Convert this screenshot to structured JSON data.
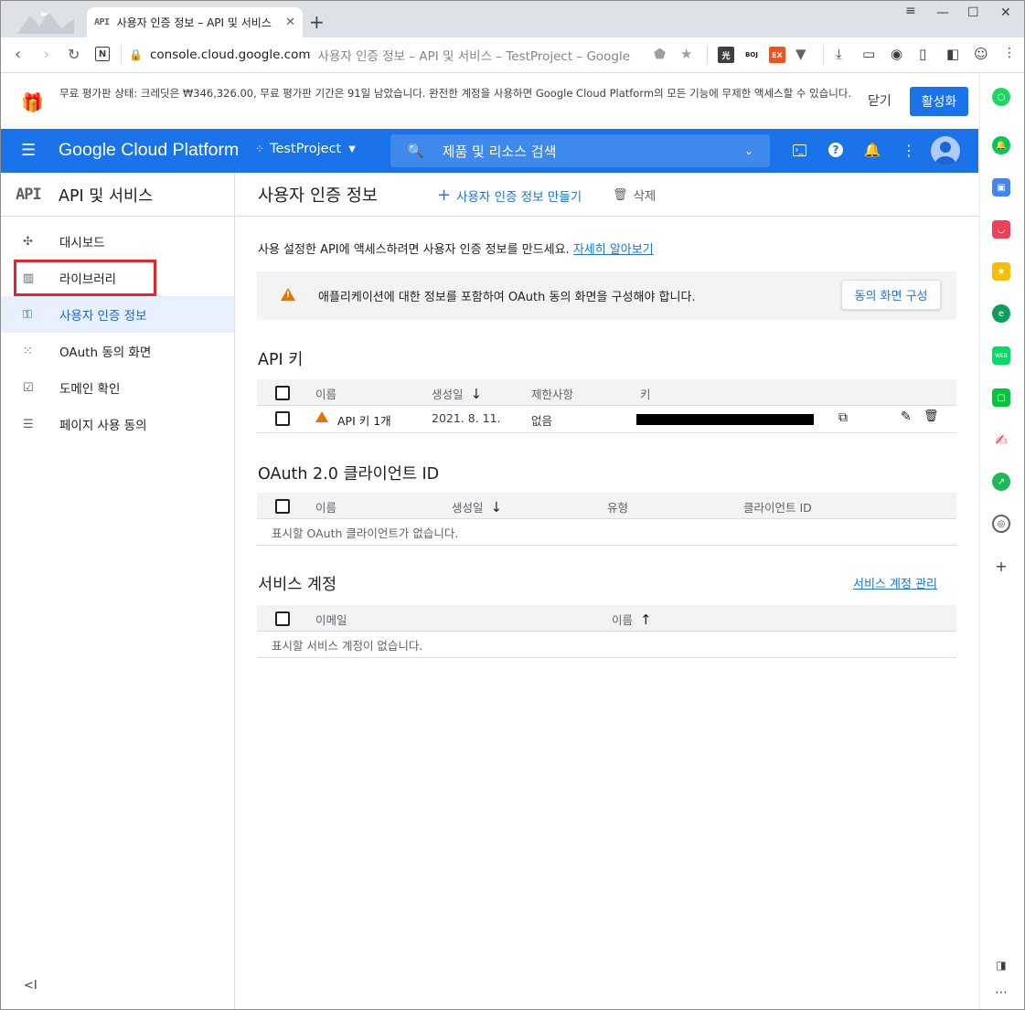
{
  "browser": {
    "tab_title": "사용자 인증 정보 – API 및 서비스",
    "tab_favicon": "API",
    "url_host": "console.cloud.google.com",
    "url_rest": "사용자 인증 정보 – API 및 서비스 – TestProject – Google",
    "extensions": [
      "光",
      "BOJ",
      "EX"
    ]
  },
  "banner": {
    "message": "무료 평가판 상태: 크레딧은 ₩346,326.00, 무료 평가판 기간은 91일 남았습니다. 완전한 계정을 사용하면 Google Cloud Platform의 모든 기능에 무제한 액세스할 수 있습니다.",
    "close_label": "닫기",
    "activate_label": "활성화"
  },
  "header": {
    "brand": "Google Cloud Platform",
    "project": "TestProject",
    "search_placeholder": "제품 및 리소스 검색"
  },
  "sidebar": {
    "logo": "API",
    "title": "API 및 서비스",
    "items": [
      {
        "label": "대시보드",
        "icon": "dashboard-icon",
        "active": false
      },
      {
        "label": "라이브러리",
        "icon": "library-icon",
        "active": false
      },
      {
        "label": "사용자 인증 정보",
        "icon": "key-icon",
        "active": true
      },
      {
        "label": "OAuth 동의 화면",
        "icon": "oauth-icon",
        "active": false
      },
      {
        "label": "도메인 확인",
        "icon": "domain-check-icon",
        "active": false
      },
      {
        "label": "페이지 사용 동의",
        "icon": "page-consent-icon",
        "active": false
      }
    ],
    "collapse_label": "<I"
  },
  "page": {
    "title": "사용자 인증 정보",
    "create_label": "사용자 인증 정보 만들기",
    "delete_label": "삭제",
    "intro": "사용 설정한 API에 액세스하려면 사용자 인증 정보를 만드세요.",
    "learn_more": "자세히 알아보기",
    "warning": "애플리케이션에 대한 정보를 포함하여 OAuth 동의 화면을 구성해야 합니다.",
    "configure_button": "동의 화면 구성"
  },
  "api_keys": {
    "title": "API 키",
    "columns": [
      "이름",
      "생성일",
      "제한사항",
      "키"
    ],
    "rows": [
      {
        "name": "API 키 1개",
        "created": "2021. 8. 11.",
        "restriction": "없음"
      }
    ]
  },
  "oauth_clients": {
    "title": "OAuth 2.0 클라이언트 ID",
    "columns": [
      "이름",
      "생성일",
      "유형",
      "클라이언트 ID"
    ],
    "empty": "표시할 OAuth 클라이언트가 없습니다."
  },
  "service_accounts": {
    "title": "서비스 계정",
    "manage_label": "서비스 계정 관리",
    "columns": [
      "이메일",
      "이름"
    ],
    "empty": "표시할 서비스 계정이 없습니다."
  },
  "colors": {
    "primary": "#1a73e8",
    "warning": "#e37400",
    "highlight_box": "#e3242b"
  }
}
